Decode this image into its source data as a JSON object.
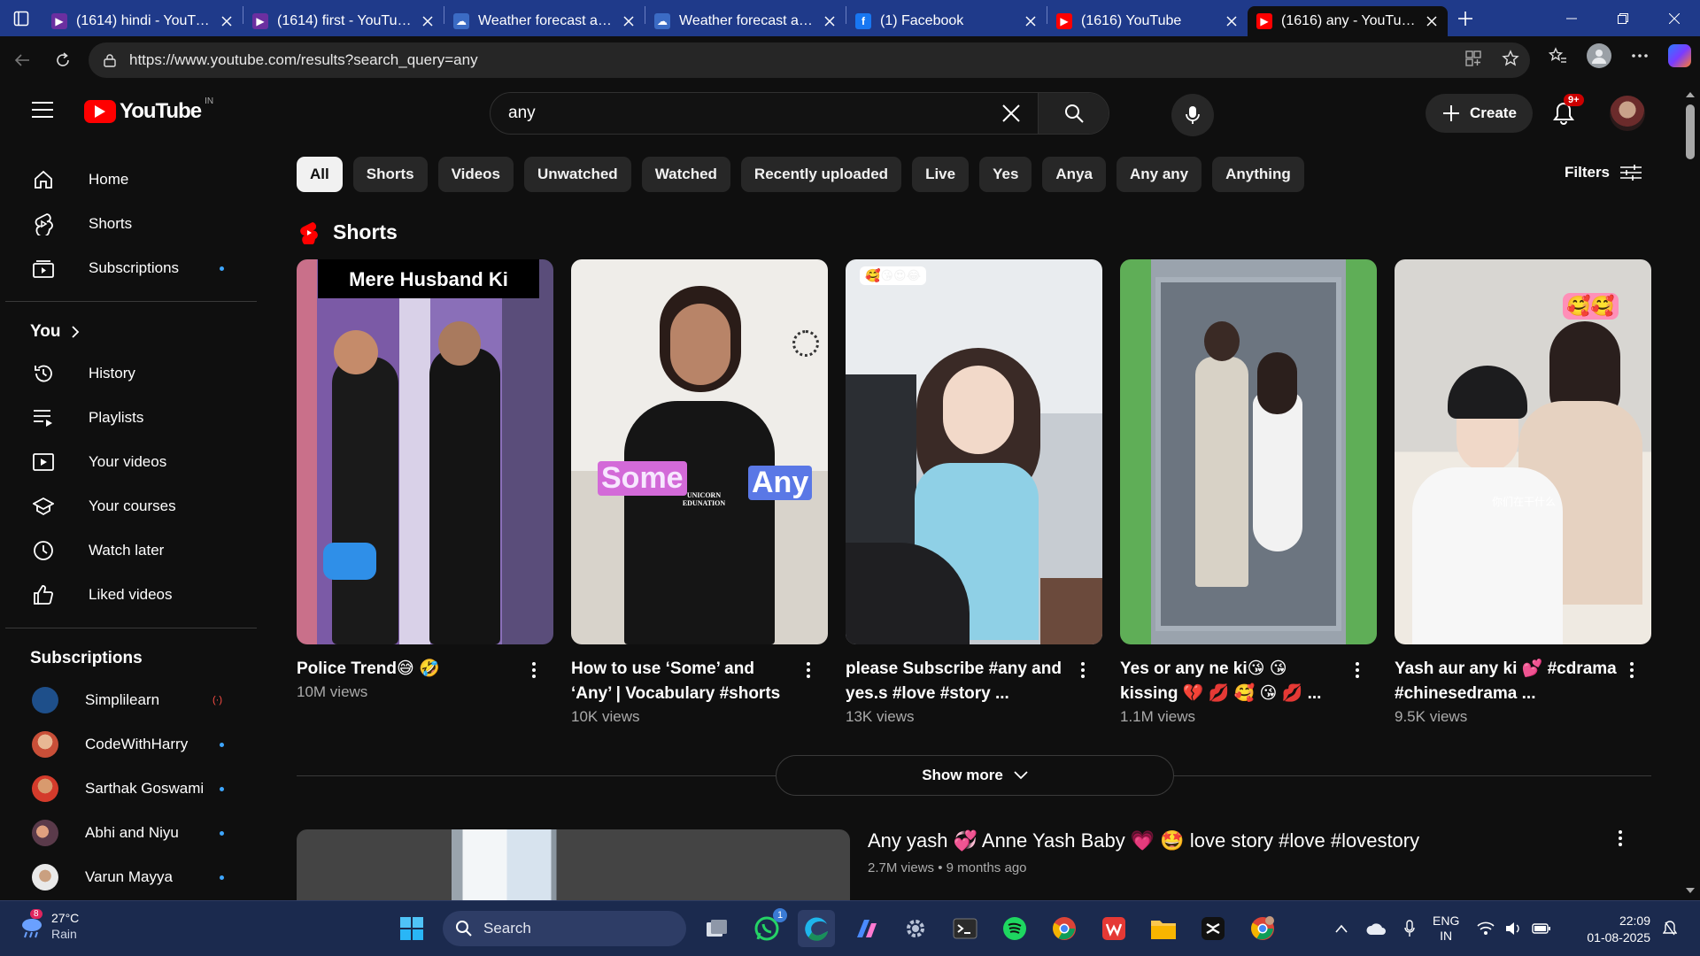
{
  "browser": {
    "tabs": [
      {
        "title": "(1614) hindi - YouTube",
        "favicon": "youtube-studio"
      },
      {
        "title": "(1614) first - YouTube",
        "favicon": "youtube-studio"
      },
      {
        "title": "Weather forecast and c",
        "favicon": "weather"
      },
      {
        "title": "Weather forecast and c",
        "favicon": "weather"
      },
      {
        "title": "(1) Facebook",
        "favicon": "facebook"
      },
      {
        "title": "(1616) YouTube",
        "favicon": "youtube"
      },
      {
        "title": "(1616) any - YouTube",
        "favicon": "youtube",
        "active": true
      }
    ],
    "url": "https://www.youtube.com/results?search_query=any"
  },
  "youtube": {
    "logo_text": "YouTube",
    "country_code": "IN",
    "search_value": "any",
    "create_label": "Create",
    "notif_count": "9+",
    "accent": "#ff0000"
  },
  "sidebar": {
    "main": [
      {
        "label": "Home",
        "icon": "home-icon"
      },
      {
        "label": "Shorts",
        "icon": "shorts-icon"
      },
      {
        "label": "Subscriptions",
        "icon": "subscriptions-icon"
      }
    ],
    "you_label": "You",
    "you": [
      {
        "label": "History",
        "icon": "history-icon"
      },
      {
        "label": "Playlists",
        "icon": "playlists-icon"
      },
      {
        "label": "Your videos",
        "icon": "your-videos-icon"
      },
      {
        "label": "Your courses",
        "icon": "courses-icon"
      },
      {
        "label": "Watch later",
        "icon": "clock-icon"
      },
      {
        "label": "Liked videos",
        "icon": "thumbs-up-icon"
      }
    ],
    "subs_label": "Subscriptions",
    "subs": [
      {
        "label": "Simplilearn",
        "live": true
      },
      {
        "label": "CodeWithHarry"
      },
      {
        "label": "Sarthak Goswami"
      },
      {
        "label": "Abhi and Niyu"
      },
      {
        "label": "Varun Mayya"
      }
    ]
  },
  "chips": [
    "All",
    "Shorts",
    "Videos",
    "Unwatched",
    "Watched",
    "Recently uploaded",
    "Live",
    "Yes",
    "Anya",
    "Any any",
    "Anything"
  ],
  "filters_label": "Filters",
  "shorts": {
    "heading": "Shorts",
    "items": [
      {
        "title": "Police Trend😅 🤣",
        "views": "10M views",
        "caption": "Mere Husband Ki Salary Anye Ke Bad"
      },
      {
        "title": "How to use ‘Some’ and ‘Any’ | Vocabulary #shorts",
        "views": "10K views",
        "word1": "Some",
        "word2": "Any",
        "brand": "UNICORN EDUNATION"
      },
      {
        "title": "please Subscribe #any and yes.s #love #story ...",
        "views": "13K views",
        "emoji": "🥰😘😍😂"
      },
      {
        "title": "Yes or any ne ki😘 😘 kissing 💔 💋 🥰 😘 💋 ...",
        "views": "1.1M views"
      },
      {
        "title": "Yash aur any ki 💕 #cdrama #chinesedrama ...",
        "views": "9.5K views",
        "emoji": "🥰🥰",
        "subtitle": "你们在干什么"
      }
    ],
    "show_more": "Show more"
  },
  "video": {
    "title": "Any yash 💞 Anne Yash Baby 💗 🤩 love story #love #lovestory",
    "meta": "2.7M views • 9 months ago"
  },
  "taskbar": {
    "weather_temp": "27°C",
    "weather_desc": "Rain",
    "weather_badge": "8",
    "search_label": "Search",
    "whatsapp_badge": "1",
    "lang_top": "ENG",
    "lang_bottom": "IN",
    "time": "22:09",
    "date": "01-08-2025"
  }
}
